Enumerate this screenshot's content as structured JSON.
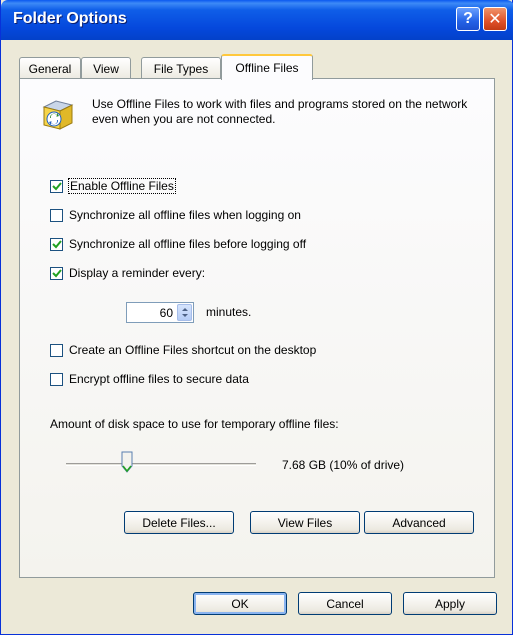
{
  "window": {
    "title": "Folder Options",
    "help_glyph": "?",
    "close_glyph": "✕"
  },
  "tabs": [
    {
      "label": "General",
      "active": false
    },
    {
      "label": "View",
      "active": false
    },
    {
      "label": "File Types",
      "active": false
    },
    {
      "label": "Offline Files",
      "active": true
    }
  ],
  "intro": {
    "icon": "offline-files-sync-icon",
    "text": "Use Offline Files to work with files and programs stored on the network even when you are not connected."
  },
  "options": [
    {
      "label": "Enable Offline Files",
      "checked": true
    },
    {
      "label": "Synchronize all offline files when logging on",
      "checked": false
    },
    {
      "label": "Synchronize all offline files before logging off",
      "checked": true
    },
    {
      "label": "Display a reminder every:",
      "checked": true
    },
    {
      "label": "Create an Offline Files shortcut on the desktop",
      "checked": false
    },
    {
      "label": "Encrypt offline files to secure data",
      "checked": false
    }
  ],
  "reminder": {
    "value": "60",
    "unit": "minutes."
  },
  "disk_space": {
    "label": "Amount of disk space to use for temporary offline files:",
    "readout": "7.68 GB (10% of drive)",
    "percent": 10
  },
  "action_buttons": {
    "delete": "Delete Files...",
    "view": "View Files",
    "advanced": "Advanced"
  },
  "dialog_buttons": {
    "ok": "OK",
    "cancel": "Cancel",
    "apply": "Apply"
  },
  "colors": {
    "title_bar": "#0548dc",
    "window_face": "#ece9d8",
    "active_tab_accent": "#ffc83c",
    "close_button": "#e0512a"
  }
}
